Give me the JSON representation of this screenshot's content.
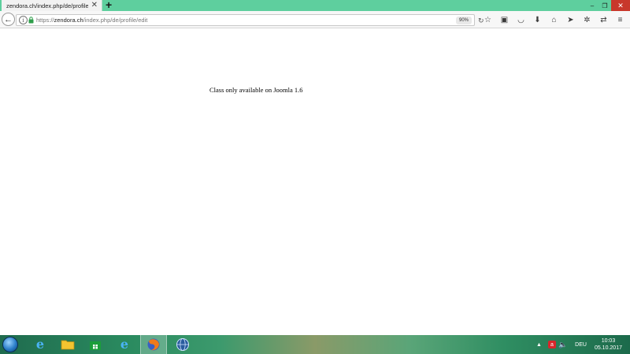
{
  "browser": {
    "tab_title": "zendora.ch/index.php/de/profile/edit",
    "tab_close_icon": "close-icon",
    "new_tab_label": "+",
    "window": {
      "minimize": "–",
      "maximize": "❐",
      "close": "✕"
    },
    "url_scheme": "https://",
    "url_host": "zendora.ch",
    "url_path": "/index.php/de/profile/edit",
    "zoom": "90%",
    "toolbar_icons": [
      "star-icon",
      "reader-icon",
      "pocket-icon",
      "download-icon",
      "home-icon",
      "send-icon",
      "extension-icon",
      "sidebar-icon",
      "menu-icon"
    ]
  },
  "page": {
    "message": "Class only available on Joomla 1.6"
  },
  "taskbar": {
    "apps": [
      "internet-explorer",
      "file-explorer",
      "store",
      "internet-explorer",
      "firefox",
      "network-app"
    ],
    "active_app": "firefox",
    "language": "DEU",
    "time": "10:03",
    "date": "05.10.2017",
    "tray_badge": "a"
  }
}
